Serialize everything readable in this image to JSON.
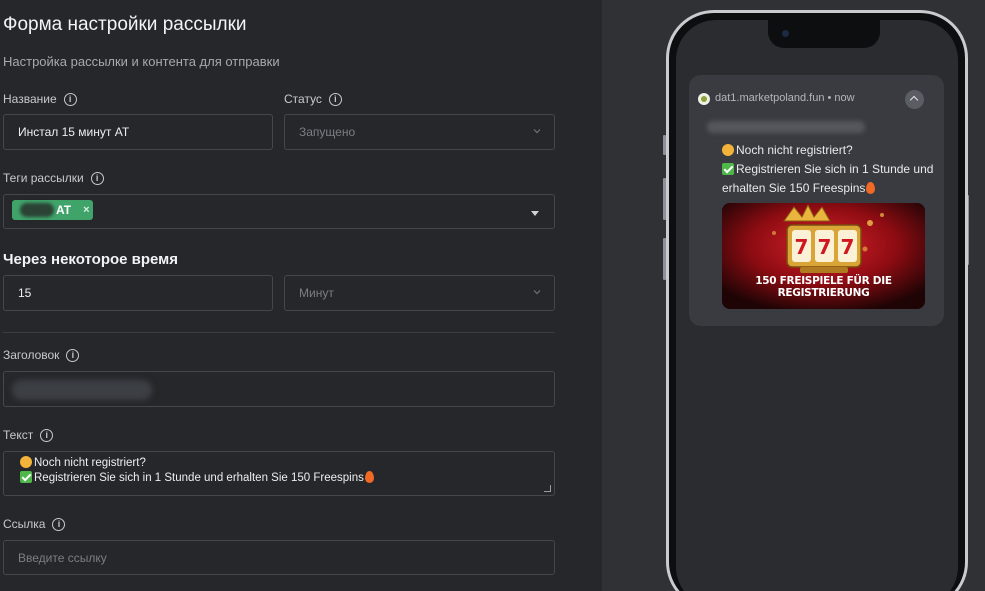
{
  "form": {
    "title": "Форма настройки рассылки",
    "subtitle": "Настройка рассылки и контента для отправки",
    "name": {
      "label": "Название",
      "value": "Инстал 15 минут AT"
    },
    "status": {
      "label": "Статус",
      "placeholder": "Запущено"
    },
    "tags": {
      "label": "Теги рассылки",
      "chips": [
        {
          "text": "AT",
          "remove_glyph": "×"
        }
      ]
    },
    "delay": {
      "heading": "Через некоторое время",
      "value": "15",
      "unit_placeholder": "Минут"
    },
    "header_field": {
      "label": "Заголовок"
    },
    "text": {
      "label": "Текст",
      "line1": "Noch nicht registriert?",
      "line2": "Registrieren Sie sich in 1 Stunde und erhalten Sie 150 Freespins"
    },
    "link": {
      "label": "Ссылка",
      "placeholder": "Введите ссылку"
    },
    "info_glyph": "i"
  },
  "preview": {
    "notification": {
      "source": "dat1.marketpoland.fun • now",
      "line1": "Noch nicht registriert?",
      "line2": "Registrieren Sie sich in 1 Stunde und erhalten Sie 150 Freespins",
      "image_caption": "150 FREISPIELE FÜR DIE REGISTRIERUNG",
      "slot_symbols": "777"
    }
  },
  "icons": [
    "info-icon",
    "chevron-down-icon",
    "caret-down-icon",
    "close-icon",
    "collapse-icon",
    "site-logo-icon"
  ],
  "colors": {
    "tag_chip": "#3fa36a",
    "panel_bg": "#25272b",
    "preview_bg": "#2f3135",
    "notification_bg": "#393b40"
  }
}
